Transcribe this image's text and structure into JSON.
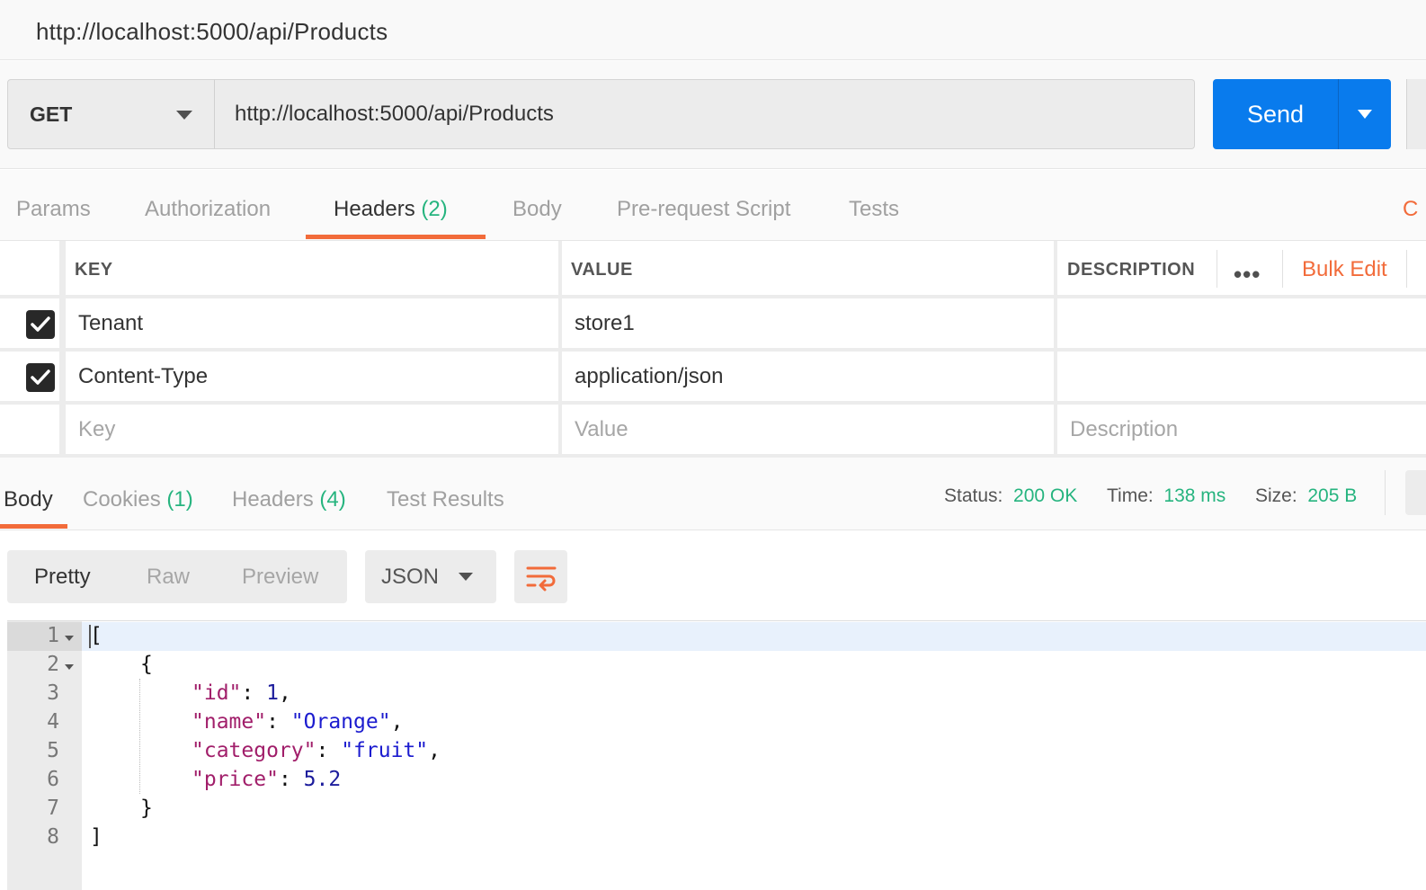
{
  "window": {
    "title": "http://localhost:5000/api/Products"
  },
  "request": {
    "method": "GET",
    "url": "http://localhost:5000/api/Products",
    "send_label": "Send"
  },
  "request_tabs": [
    {
      "label": "Params",
      "count": ""
    },
    {
      "label": "Authorization",
      "count": ""
    },
    {
      "label": "Headers",
      "count": "(2)"
    },
    {
      "label": "Body",
      "count": ""
    },
    {
      "label": "Pre-request Script",
      "count": ""
    },
    {
      "label": "Tests",
      "count": ""
    }
  ],
  "active_request_tab": "Headers",
  "headers_table": {
    "columns": {
      "key": "KEY",
      "value": "VALUE",
      "description": "DESCRIPTION"
    },
    "bulk_edit": "Bulk Edit",
    "rows": [
      {
        "checked": true,
        "key": "Tenant",
        "value": "store1",
        "description": ""
      },
      {
        "checked": true,
        "key": "Content-Type",
        "value": "application/json",
        "description": ""
      }
    ],
    "placeholders": {
      "key": "Key",
      "value": "Value",
      "description": "Description"
    }
  },
  "response_tabs": [
    {
      "label": "Body",
      "count": ""
    },
    {
      "label": "Cookies",
      "count": "(1)"
    },
    {
      "label": "Headers",
      "count": "(4)"
    },
    {
      "label": "Test Results",
      "count": ""
    }
  ],
  "active_response_tab": "Body",
  "response_meta": {
    "status_label": "Status:",
    "status": "200 OK",
    "time_label": "Time:",
    "time": "138 ms",
    "size_label": "Size:",
    "size": "205 B"
  },
  "response_view": {
    "modes": [
      "Pretty",
      "Raw",
      "Preview"
    ],
    "active_mode": "Pretty",
    "format": "JSON"
  },
  "response_body": {
    "line_numbers": [
      "1",
      "2",
      "3",
      "4",
      "5",
      "6",
      "7",
      "8"
    ],
    "open_bracket": "[",
    "open_brace": "{",
    "fields": [
      {
        "key": "\"id\"",
        "value": "1",
        "type": "number",
        "comma": ","
      },
      {
        "key": "\"name\"",
        "value": "\"Orange\"",
        "type": "string",
        "comma": ","
      },
      {
        "key": "\"category\"",
        "value": "\"fruit\"",
        "type": "string",
        "comma": ","
      },
      {
        "key": "\"price\"",
        "value": "5.2",
        "type": "number",
        "comma": ""
      }
    ],
    "close_brace": "}",
    "close_bracket": "]"
  },
  "colors": {
    "accent": "#f26b3a",
    "send": "#097bed",
    "count_green": "#26b47f",
    "json_key": "#a11e6a",
    "json_string": "#1c1ccf",
    "json_number": "#1c1c9c"
  }
}
